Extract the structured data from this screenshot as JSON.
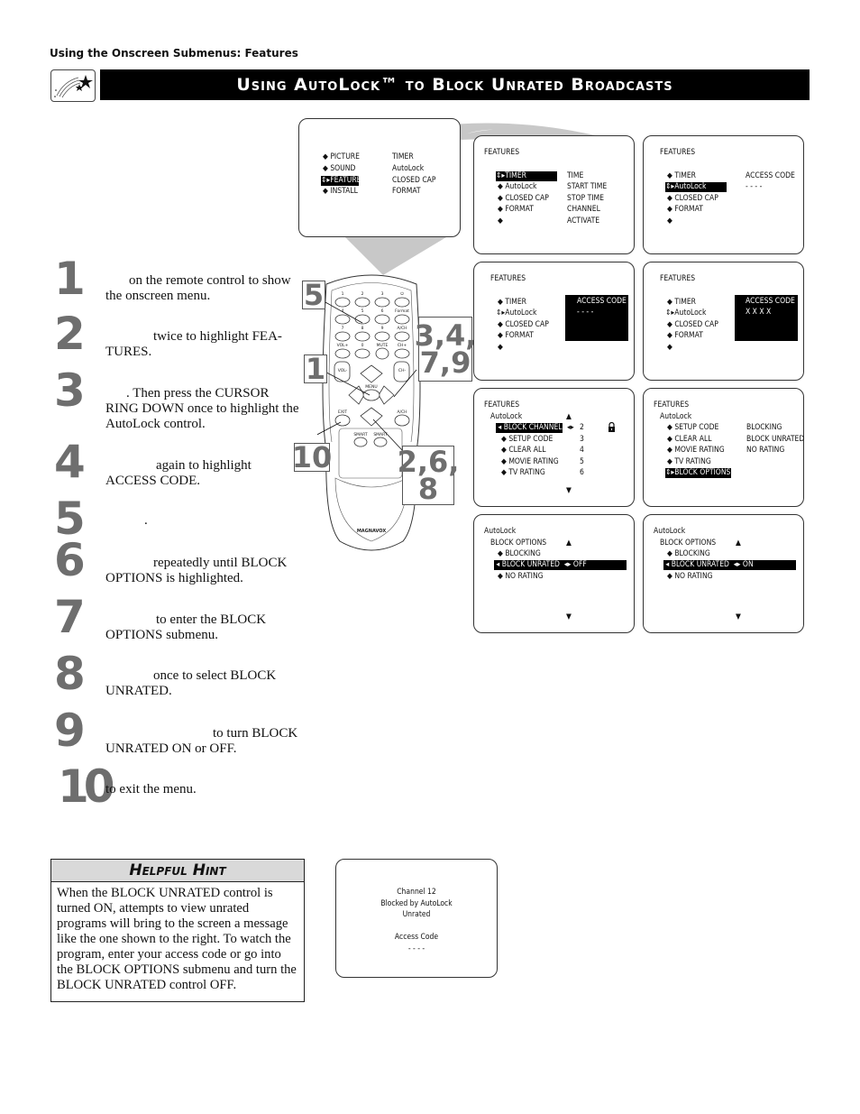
{
  "header": {
    "section_label": "Using the Onscreen Submenus: Features",
    "title": "Using AutoLock™ to Block Unrated Broadcasts",
    "title_icon": "shooting-stars-icon"
  },
  "steps": [
    {
      "num": "1",
      "text": "on the remote control to show the onscreen menu."
    },
    {
      "num": "2",
      "text": "twice to highlight FEA- TURES."
    },
    {
      "num": "3",
      "text": ". Then press the CURSOR RING DOWN once to highlight the AutoLock control."
    },
    {
      "num": "4",
      "text": "again to highlight ACCESS CODE."
    },
    {
      "num": "5",
      "text": "."
    },
    {
      "num": "6",
      "text": "repeatedly until BLOCK OPTIONS is highlighted."
    },
    {
      "num": "7",
      "text": "to enter the BLOCK OPTIONS submenu."
    },
    {
      "num": "8",
      "text": "once to select BLOCK UNRATED."
    },
    {
      "num": "9",
      "text": "to turn BLOCK UNRATED ON or OFF."
    },
    {
      "num": "10",
      "text": "to exit the menu."
    }
  ],
  "remote": {
    "brand": "MAGNAVOX",
    "keys": [
      "1",
      "2",
      "3",
      "⏻",
      "4",
      "5",
      "6",
      "Format",
      "7",
      "8",
      "9",
      "A/CH",
      "VOL+",
      "0",
      "MUTE",
      "CH+",
      "VOL-",
      "CH-",
      "MENU",
      "EXIT",
      "A/CH",
      "SMART",
      "SMART"
    ],
    "callouts": [
      "5",
      "1",
      "3,4, 7,9",
      "10",
      "2,6, 8"
    ]
  },
  "screens": {
    "main_menu": {
      "left": [
        "PICTURE",
        "SOUND",
        "FEATURES",
        "INSTALL"
      ],
      "right": [
        "TIMER",
        "AutoLock",
        "CLOSED CAP",
        "FORMAT"
      ],
      "selected": "FEATURES"
    },
    "s1": {
      "title": "FEATURES",
      "left": [
        "TIMER",
        "AutoLock",
        "CLOSED CAP",
        "FORMAT",
        ""
      ],
      "right": [
        "TIME",
        "START TIME",
        "STOP TIME",
        "CHANNEL",
        "ACTIVATE"
      ]
    },
    "s2": {
      "title": "FEATURES",
      "left": [
        "TIMER",
        "AutoLock",
        "CLOSED CAP",
        "FORMAT",
        ""
      ],
      "right_label": "ACCESS CODE",
      "right_value": "- - - -"
    },
    "s3": {
      "title": "FEATURES",
      "left": [
        "TIMER",
        "AutoLock",
        "CLOSED CAP",
        "FORMAT",
        ""
      ],
      "right_label": "ACCESS CODE",
      "right_value": "- - - -"
    },
    "s4": {
      "title": "FEATURES",
      "left": [
        "TIMER",
        "AutoLock",
        "CLOSED CAP",
        "FORMAT",
        ""
      ],
      "right_label": "ACCESS CODE",
      "right_value": "X X X X"
    },
    "s5": {
      "title": "FEATURES",
      "sub": "AutoLock",
      "left": [
        "BLOCK CHANNEL",
        "SETUP CODE",
        "CLEAR ALL",
        "MOVIE RATING",
        "TV RATING"
      ],
      "values": [
        "2",
        "3",
        "4",
        "5",
        "6"
      ],
      "lock_icon": "padlock-icon"
    },
    "s6": {
      "title": "FEATURES",
      "sub": "AutoLock",
      "left": [
        "SETUP CODE",
        "CLEAR ALL",
        "MOVIE RATING",
        "TV RATING",
        "BLOCK OPTIONS"
      ],
      "right": [
        "BLOCKING",
        "BLOCK UNRATED",
        "NO RATING"
      ]
    },
    "s7": {
      "title": "AutoLock",
      "sub": "BLOCK OPTIONS",
      "left": [
        "BLOCKING",
        "BLOCK UNRATED",
        "NO RATING"
      ],
      "value": "OFF"
    },
    "s8": {
      "title": "AutoLock",
      "sub": "BLOCK OPTIONS",
      "left": [
        "BLOCKING",
        "BLOCK UNRATED",
        "NO RATING"
      ],
      "value": "ON"
    },
    "blocked": {
      "lines": [
        "Channel 12",
        "Blocked by AutoLock",
        "Unrated",
        "",
        "Access Code",
        "- - - -"
      ]
    }
  },
  "hint": {
    "title": "Helpful Hint",
    "body": "When the BLOCK UNRATED control is turned ON, attempts to view unrated programs will bring to the screen a message like the one shown to the right. To watch the program, enter your access code or go into the BLOCK OPTIONS submenu and turn the BLOCK UNRATED control OFF."
  }
}
